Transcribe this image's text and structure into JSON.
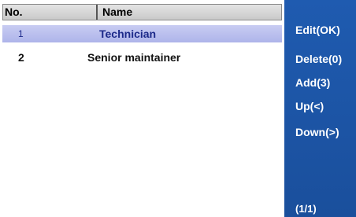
{
  "table": {
    "headers": {
      "no": "No.",
      "name": "Name"
    },
    "rows": [
      {
        "no": "1",
        "name": "Technician",
        "selected": true
      },
      {
        "no": "2",
        "name": "Senior maintainer",
        "selected": false
      }
    ]
  },
  "sidebar": {
    "buttons": [
      {
        "label": "Edit(OK)"
      },
      {
        "label": "Delete(0)"
      },
      {
        "label": "Add(3)"
      },
      {
        "label": "Up(<)"
      },
      {
        "label": "Down(>)"
      }
    ],
    "page_indicator": "(1/1)"
  },
  "colors": {
    "sidebar": "#1f5bb0",
    "selected_row": "#b8bdee",
    "header": "#d6d6d6"
  }
}
